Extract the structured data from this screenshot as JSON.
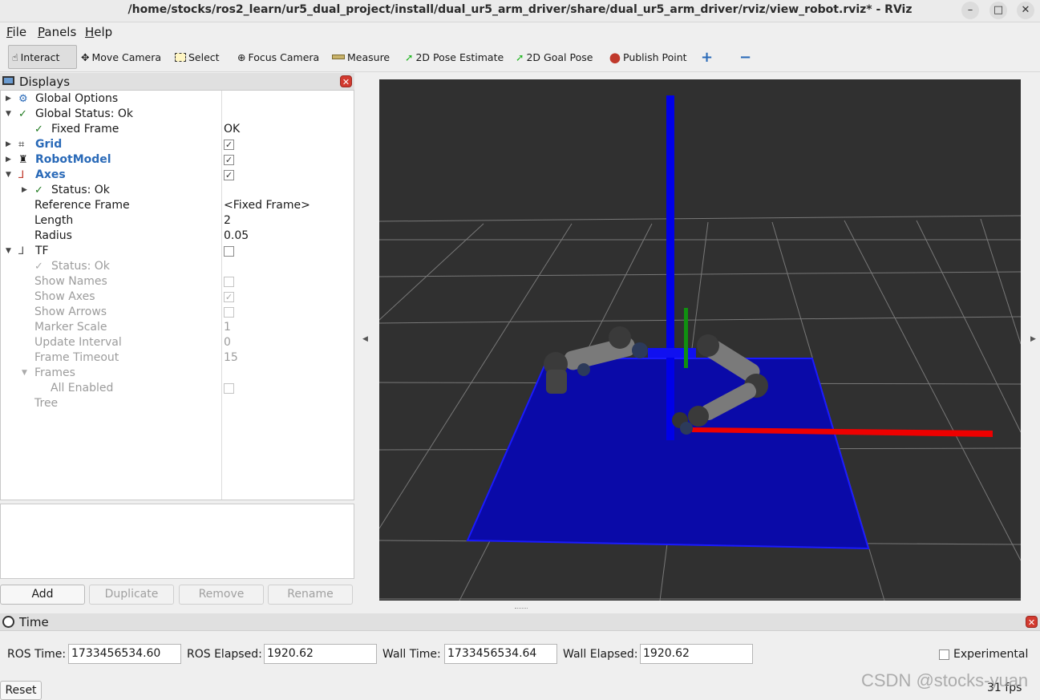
{
  "window": {
    "title": "/home/stocks/ros2_learn/ur5_dual_project/install/dual_ur5_arm_driver/share/dual_ur5_arm_driver/rviz/view_robot.rviz* - RViz",
    "minimize": "–",
    "maximize": "□",
    "close": "✕"
  },
  "menu": [
    "File",
    "Panels",
    "Help"
  ],
  "toolbar": {
    "interact": "Interact",
    "move_camera": "Move Camera",
    "select": "Select",
    "focus_camera": "Focus Camera",
    "measure": "Measure",
    "pose_estimate": "2D Pose Estimate",
    "goal_pose": "2D Goal Pose",
    "publish_point": "Publish Point",
    "add_tool": "+",
    "remove_tool": "−"
  },
  "displays": {
    "title": "Displays",
    "rows": [
      {
        "label": "Global Options"
      },
      {
        "label": "Global Status: Ok"
      },
      {
        "label": "Fixed Frame",
        "value": "OK"
      },
      {
        "label": "Grid",
        "checked": "✓"
      },
      {
        "label": "RobotModel",
        "checked": "✓"
      },
      {
        "label": "Axes",
        "checked": "✓"
      },
      {
        "label": "Status: Ok"
      },
      {
        "label": "Reference Frame",
        "value": "<Fixed Frame>"
      },
      {
        "label": "Length",
        "value": "2"
      },
      {
        "label": "Radius",
        "value": "0.05"
      },
      {
        "label": "TF",
        "checked": ""
      },
      {
        "label": "Status: Ok"
      },
      {
        "label": "Show Names",
        "checked": ""
      },
      {
        "label": "Show Axes",
        "checked": "✓"
      },
      {
        "label": "Show Arrows",
        "checked": ""
      },
      {
        "label": "Marker Scale",
        "value": "1"
      },
      {
        "label": "Update Interval",
        "value": "0"
      },
      {
        "label": "Frame Timeout",
        "value": "15"
      },
      {
        "label": "Frames"
      },
      {
        "label": "All Enabled",
        "checked": ""
      },
      {
        "label": "Tree"
      }
    ],
    "buttons": {
      "add": "Add",
      "duplicate": "Duplicate",
      "remove": "Remove",
      "rename": "Rename"
    }
  },
  "time": {
    "title": "Time",
    "ros_time_label": "ROS Time:",
    "ros_time": "1733456534.60",
    "ros_elapsed_label": "ROS Elapsed:",
    "ros_elapsed": "1920.62",
    "wall_time_label": "Wall Time:",
    "wall_time": "1733456534.64",
    "wall_elapsed_label": "Wall Elapsed:",
    "wall_elapsed": "1920.62",
    "experimental": "Experimental",
    "reset": "Reset",
    "fps": "31 fps"
  },
  "watermark": "CSDN @stocks-yuan",
  "colors": {
    "viewport_bg": "#303030",
    "ground_plane": "#0a0aa8",
    "axis_x": "#ee0000",
    "axis_y": "#109010",
    "axis_z": "#0000e8",
    "accent_label": "#2a6ab8"
  }
}
